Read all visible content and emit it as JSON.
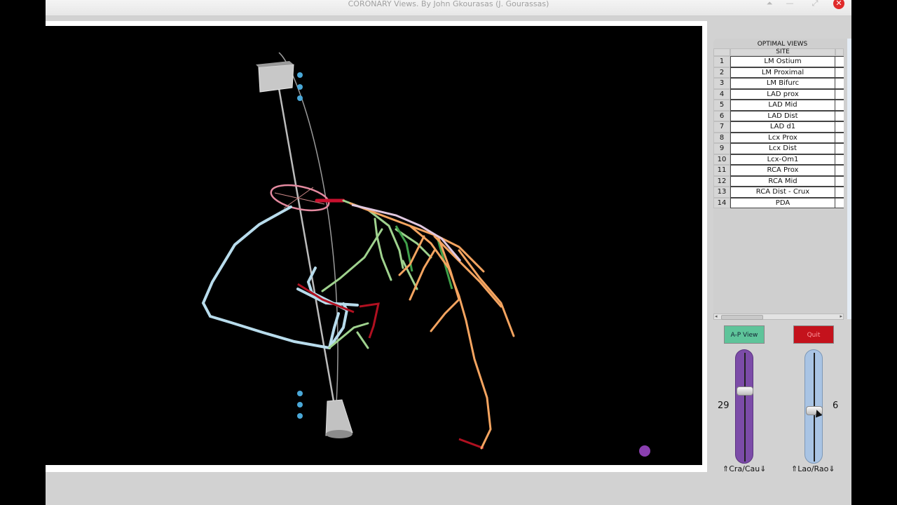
{
  "window": {
    "title": "CORONARY Views. By John Gkourasas (J. Gourassas)",
    "controls": [
      "⏶",
      "—",
      "⤢",
      "✕"
    ]
  },
  "panel": {
    "title": "OPTIMAL VIEWS",
    "column_header": "SITE",
    "rows": [
      {
        "num": "1",
        "site": "LM Ostium"
      },
      {
        "num": "2",
        "site": "LM Proximal"
      },
      {
        "num": "3",
        "site": "LM Bifurc"
      },
      {
        "num": "4",
        "site": "LAD prox"
      },
      {
        "num": "5",
        "site": "LAD Mid"
      },
      {
        "num": "6",
        "site": "LAD Dist"
      },
      {
        "num": "7",
        "site": "LAD d1"
      },
      {
        "num": "8",
        "site": "Lcx Prox"
      },
      {
        "num": "9",
        "site": "Lcx Dist"
      },
      {
        "num": "10",
        "site": "Lcx-Om1"
      },
      {
        "num": "11",
        "site": "RCA Prox"
      },
      {
        "num": "12",
        "site": "RCA Mid"
      },
      {
        "num": "13",
        "site": "RCA Dist - Crux"
      },
      {
        "num": "14",
        "site": "PDA"
      }
    ]
  },
  "buttons": {
    "ap_view": "A-P View",
    "quit": "Quit"
  },
  "sliders": {
    "cra_cau": {
      "label": "⇑Cra/Cau⇓",
      "value": "29"
    },
    "lao_rao": {
      "label": "⇑Lao/Rao⇓",
      "value": "6"
    }
  },
  "colors": {
    "rca": "#b8dcec",
    "lad": "#9fd28e",
    "lcx": "#f4a460",
    "lm": "#c8102e",
    "ring": "#e48aa0",
    "dots": "#4aa8d8",
    "indicator": "#8a3fb0"
  }
}
